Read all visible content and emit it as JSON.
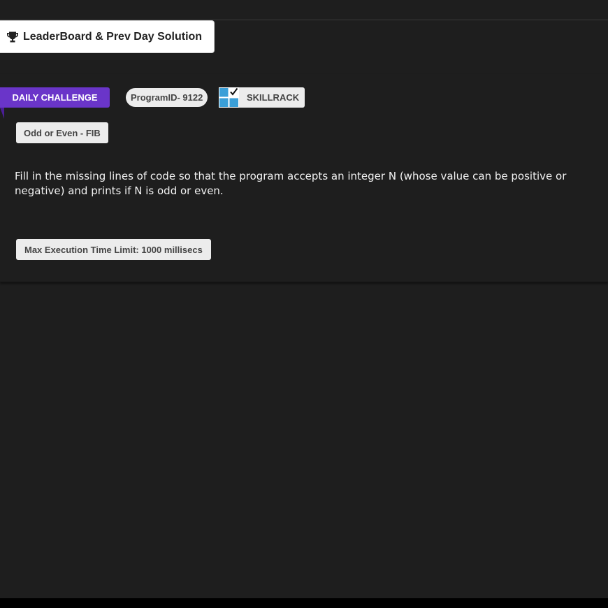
{
  "header": {
    "leaderboard_label": "LeaderBoard & Prev Day Solution",
    "leaderboard_icon": "trophy-icon"
  },
  "challenge": {
    "ribbon_label": "DAILY CHALLENGE",
    "program_id": "ProgramID- 9122",
    "platform_label": "SKILLRACK",
    "platform_icon": "skillrack-logo-icon",
    "title": "Odd or Even - FIB",
    "description": "Fill in the missing lines of code so that the program accepts an integer N (whose value can be positive or negative) and prints if N is odd or even.",
    "time_limit": "Max Execution Time Limit: 1000 millisecs"
  },
  "colors": {
    "background": "#1e1e1e",
    "ribbon": "#6a35c9",
    "chip": "#ececec",
    "chip_text": "#444444",
    "text": "#f2f2f2",
    "logo_blue": "#3a9fd8"
  }
}
